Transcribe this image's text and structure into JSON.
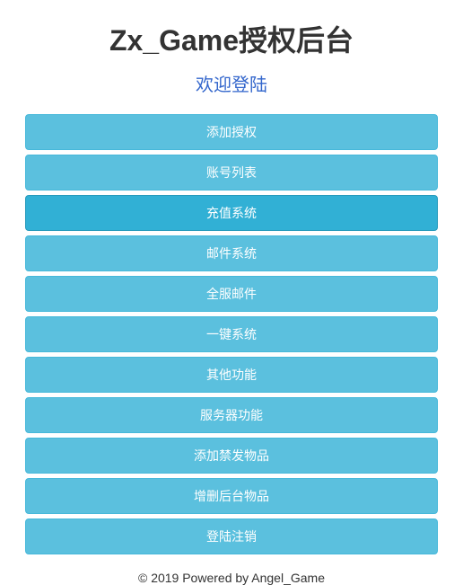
{
  "title": "Zx_Game授权后台",
  "subtitle": "欢迎登陆",
  "menu": {
    "items": [
      {
        "label": "添加授权"
      },
      {
        "label": "账号列表"
      },
      {
        "label": "充值系统"
      },
      {
        "label": "邮件系统"
      },
      {
        "label": "全服邮件"
      },
      {
        "label": "一键系统"
      },
      {
        "label": "其他功能"
      },
      {
        "label": "服务器功能"
      },
      {
        "label": "添加禁发物品"
      },
      {
        "label": "增删后台物品"
      },
      {
        "label": "登陆注销"
      }
    ],
    "activeIndex": 2
  },
  "footer": "© 2019 Powered by Angel_Game"
}
